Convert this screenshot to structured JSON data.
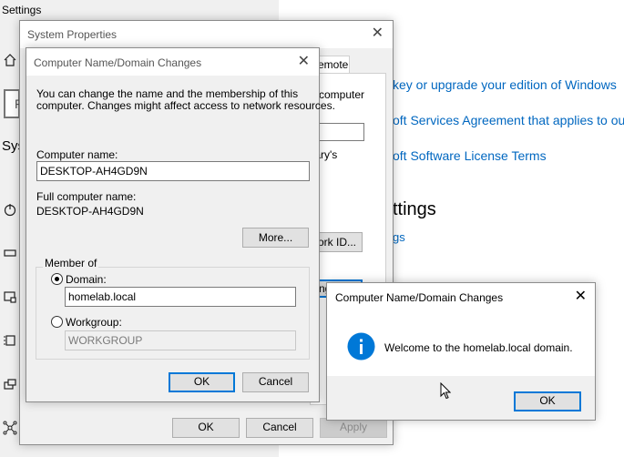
{
  "settings": {
    "title": "Settings",
    "search_placeholder": "F",
    "section_partial": "Sys",
    "links": {
      "product_key": "key or upgrade your edition of Windows",
      "services_agreement": "oft Services Agreement that applies to ou",
      "license_terms": "oft Software License Terms",
      "related_link": "gs"
    },
    "heading_partial": "ttings"
  },
  "system_properties": {
    "title": "System Properties",
    "tab_remote": "emote",
    "text_computer": "computer",
    "text_tary": "tary's",
    "button_network_id": "ork ID...",
    "button_change": "ng",
    "ok": "OK",
    "cancel": "Cancel",
    "apply": "Apply"
  },
  "name_dialog": {
    "title": "Computer Name/Domain Changes",
    "intro_line1": "You can change the name and the membership of this",
    "intro_line2": "computer. Changes might affect access to network resources.",
    "computer_name_label": "Computer name:",
    "computer_name_value": "DESKTOP-AH4GD9N",
    "full_name_label": "Full computer name:",
    "full_name_value": "DESKTOP-AH4GD9N",
    "more_button": "More...",
    "member_of_label": "Member of",
    "domain_label": "Domain:",
    "domain_value": "homelab.local",
    "workgroup_label": "Workgroup:",
    "workgroup_value": "WORKGROUP",
    "ok": "OK",
    "cancel": "Cancel"
  },
  "welcome_dialog": {
    "title": "Computer Name/Domain Changes",
    "message": "Welcome to the homelab.local domain.",
    "icon": "info-icon",
    "ok": "OK"
  },
  "colors": {
    "accent": "#0078d7",
    "link": "#0067c0",
    "info_icon": "#0078d7"
  }
}
